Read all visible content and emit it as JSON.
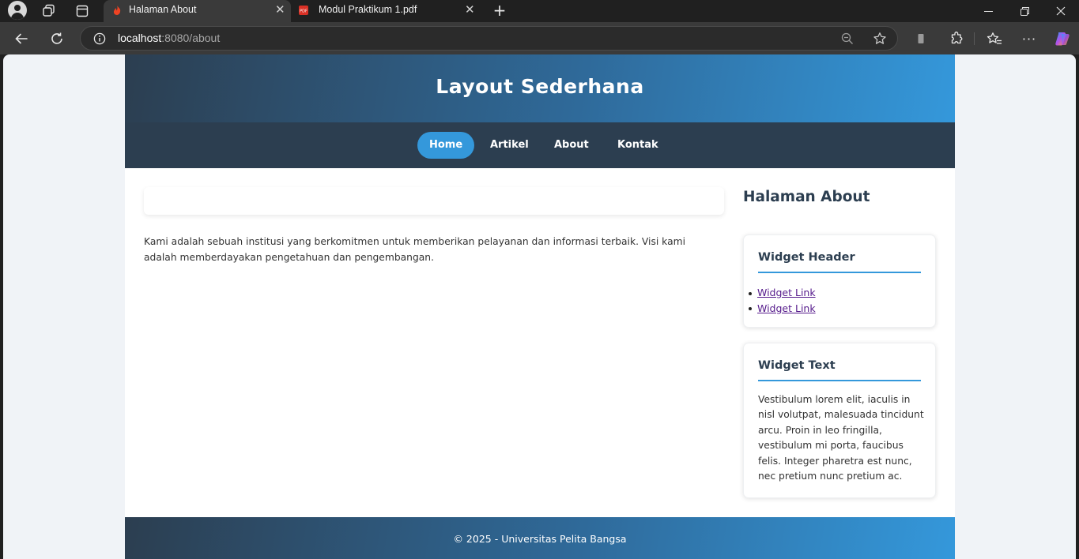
{
  "browser": {
    "tabs": [
      {
        "title": "Halaman About",
        "active": true,
        "favicon": "codeigniter-flame-icon"
      },
      {
        "title": "Modul Praktikum 1.pdf",
        "active": false,
        "favicon": "pdf-icon"
      }
    ],
    "address": {
      "host": "localhost",
      "rest": ":8080/about"
    }
  },
  "site": {
    "title": "Layout Sederhana",
    "nav": [
      {
        "label": "Home",
        "active": true
      },
      {
        "label": "Artikel",
        "active": false
      },
      {
        "label": "About",
        "active": false
      },
      {
        "label": "Kontak",
        "active": false
      }
    ],
    "main": {
      "text": "Kami adalah sebuah institusi yang berkomitmen untuk memberikan pelayanan dan informasi terbaik. Visi kami adalah memberdayakan pengetahuan dan pengembangan."
    },
    "sidebar": {
      "page_title": "Halaman About",
      "widgets": [
        {
          "header": "Widget Header",
          "links": [
            "Widget Link",
            "Widget Link"
          ]
        },
        {
          "header": "Widget Text",
          "text": "Vestibulum lorem elit, iaculis in nisl volutpat, malesuada tincidunt arcu. Proin in leo fringilla, vestibulum mi porta, faucibus felis. Integer pharetra est nunc, nec pretium nunc pretium ac."
        }
      ]
    },
    "footer": {
      "text": "© 2025 - Universitas Pelita Bangsa"
    }
  },
  "colors": {
    "header_dark": "#2c3e50",
    "accent": "#3498db",
    "link_visited": "#551a8b"
  }
}
